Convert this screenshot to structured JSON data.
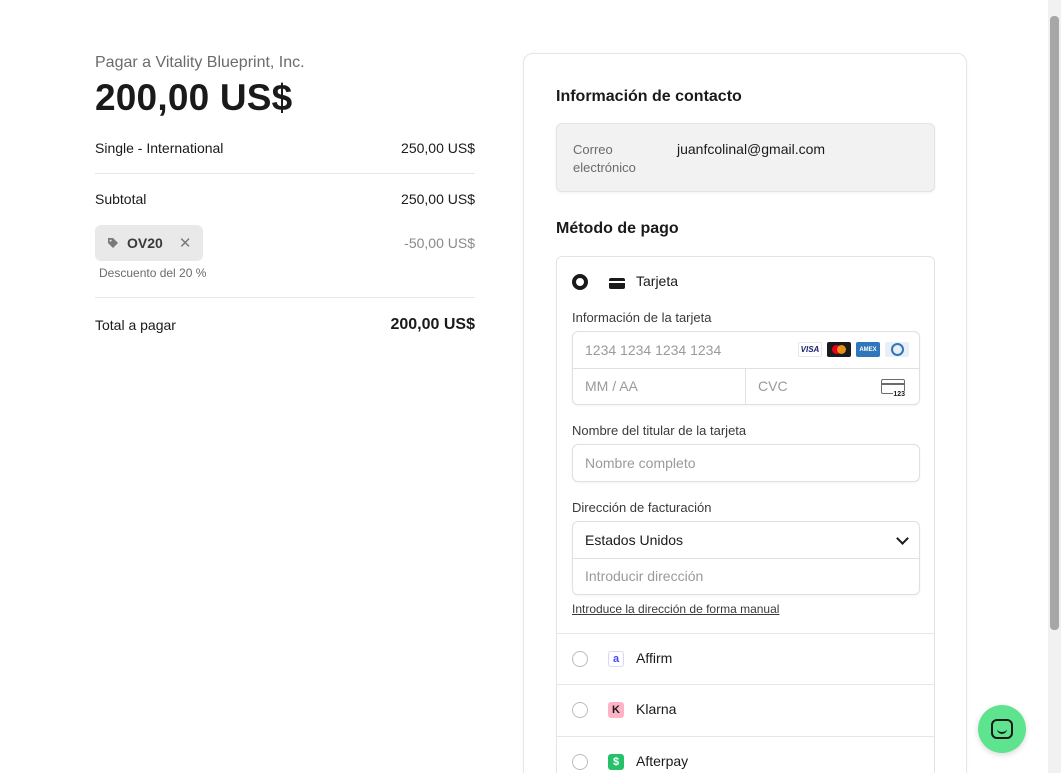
{
  "summary": {
    "merchant": "Pagar a Vitality Blueprint, Inc.",
    "total_big": "200,00 US$",
    "item": {
      "name": "Single - International",
      "price": "250,00 US$"
    },
    "subtotal": {
      "label": "Subtotal",
      "value": "250,00 US$"
    },
    "promo": {
      "code": "OV20",
      "amount": "-50,00 US$",
      "description": "Descuento del 20 %"
    },
    "total": {
      "label": "Total a pagar",
      "value": "200,00 US$"
    }
  },
  "contact": {
    "title": "Información de contacto",
    "email_label": "Correo electrónico",
    "email_value": "juanfcolinal@gmail.com"
  },
  "payment": {
    "title": "Método de pago",
    "card": {
      "label": "Tarjeta",
      "info_label": "Información de la tarjeta",
      "number_placeholder": "1234 1234 1234 1234",
      "expiry_placeholder": "MM / AA",
      "cvc_placeholder": "CVC",
      "cvc_badge": "123",
      "brands": [
        "VISA",
        "Mastercard",
        "AMEX",
        "Diners"
      ],
      "holder_label": "Nombre del titular de la tarjeta",
      "holder_placeholder": "Nombre completo",
      "billing_label": "Dirección de facturación",
      "country": "Estados Unidos",
      "address_placeholder": "Introducir dirección",
      "manual_link": "Introduce la dirección de forma manual"
    },
    "methods": [
      {
        "label": "Affirm",
        "icon": "affirm-icon",
        "icon_text": "a",
        "color": "#4a4af4"
      },
      {
        "label": "Klarna",
        "icon": "klarna-icon",
        "icon_text": "K",
        "color": "#ffb3c7"
      },
      {
        "label": "Afterpay",
        "icon": "afterpay-icon",
        "icon_text": "$",
        "color": "#26c26a"
      }
    ]
  },
  "colors": {
    "chat_button": "#5ee38e"
  }
}
